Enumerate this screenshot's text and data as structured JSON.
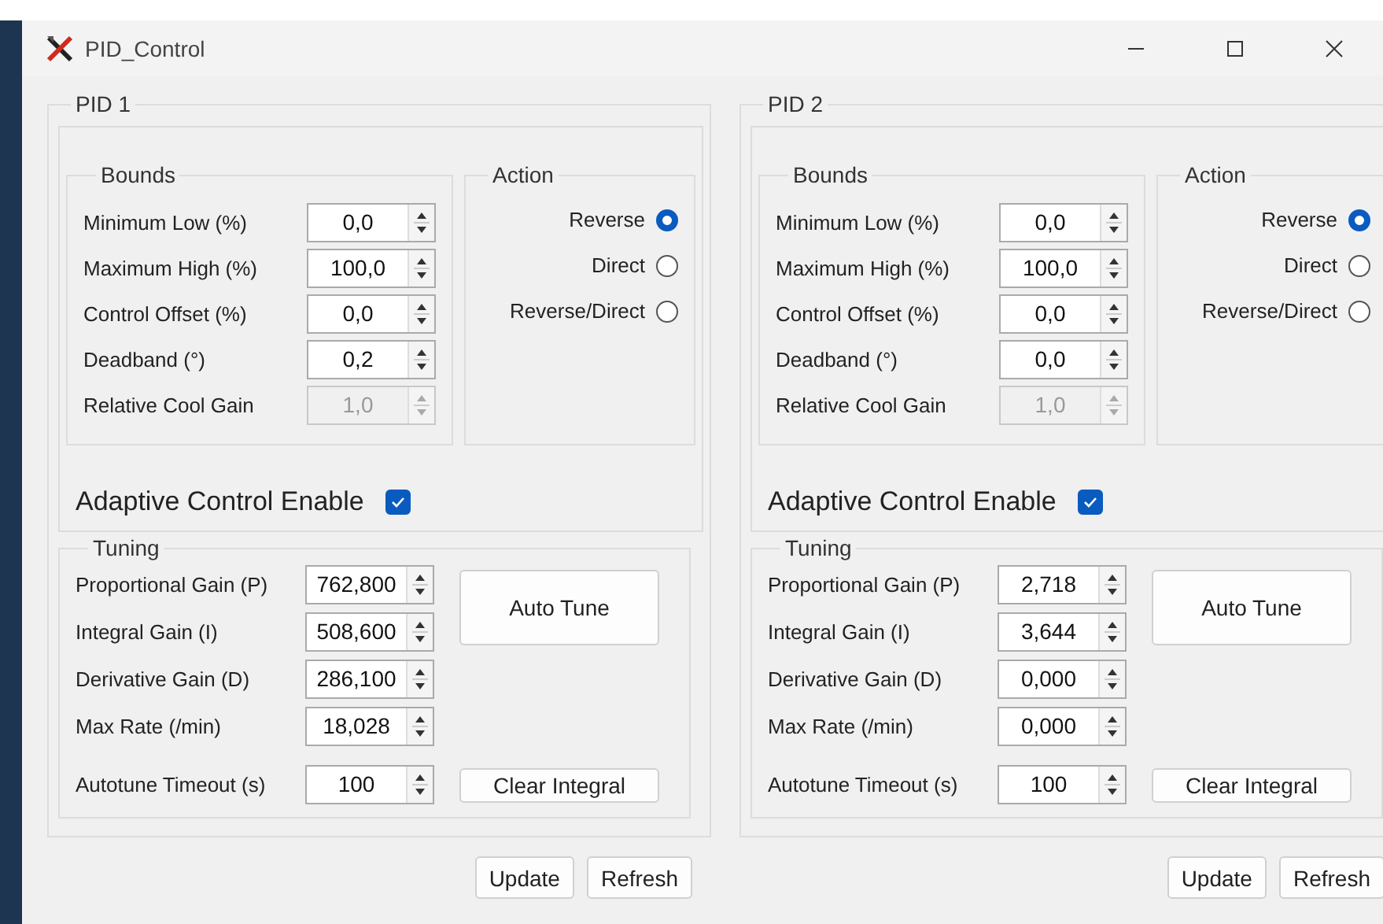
{
  "window": {
    "title": "PID_Control"
  },
  "panels": [
    {
      "title": "PID 1",
      "bounds": {
        "title": "Bounds",
        "fields": [
          {
            "label": "Minimum Low (%)",
            "value": "0,0",
            "disabled": false
          },
          {
            "label": "Maximum High (%)",
            "value": "100,0",
            "disabled": false
          },
          {
            "label": "Control Offset (%)",
            "value": "0,0",
            "disabled": false
          },
          {
            "label": "Deadband (°)",
            "value": "0,2",
            "disabled": false
          },
          {
            "label": "Relative Cool Gain",
            "value": "1,0",
            "disabled": true
          }
        ]
      },
      "action": {
        "title": "Action",
        "options": [
          {
            "label": "Reverse",
            "selected": true
          },
          {
            "label": "Direct",
            "selected": false
          },
          {
            "label": "Reverse/Direct",
            "selected": false
          }
        ]
      },
      "adaptive": {
        "label": "Adaptive Control Enable",
        "checked": true
      },
      "tuning": {
        "title": "Tuning",
        "fields": [
          {
            "label": "Proportional Gain (P)",
            "value": "762,800"
          },
          {
            "label": "Integral Gain (I)",
            "value": "508,600"
          },
          {
            "label": "Derivative Gain (D)",
            "value": "286,100"
          },
          {
            "label": "Max Rate (/min)",
            "value": "18,028"
          }
        ],
        "auto_tune_button": "Auto Tune",
        "timeout": {
          "label": "Autotune Timeout (s)",
          "value": "100"
        },
        "clear_button": "Clear Integral"
      },
      "buttons": [
        "Update",
        "Refresh"
      ]
    },
    {
      "title": "PID 2",
      "bounds": {
        "title": "Bounds",
        "fields": [
          {
            "label": "Minimum Low (%)",
            "value": "0,0",
            "disabled": false
          },
          {
            "label": "Maximum High (%)",
            "value": "100,0",
            "disabled": false
          },
          {
            "label": "Control Offset (%)",
            "value": "0,0",
            "disabled": false
          },
          {
            "label": "Deadband (°)",
            "value": "0,0",
            "disabled": false
          },
          {
            "label": "Relative Cool Gain",
            "value": "1,0",
            "disabled": true
          }
        ]
      },
      "action": {
        "title": "Action",
        "options": [
          {
            "label": "Reverse",
            "selected": true
          },
          {
            "label": "Direct",
            "selected": false
          },
          {
            "label": "Reverse/Direct",
            "selected": false
          }
        ]
      },
      "adaptive": {
        "label": "Adaptive Control Enable",
        "checked": true
      },
      "tuning": {
        "title": "Tuning",
        "fields": [
          {
            "label": "Proportional Gain (P)",
            "value": "2,718"
          },
          {
            "label": "Integral Gain (I)",
            "value": "3,644"
          },
          {
            "label": "Derivative Gain (D)",
            "value": "0,000"
          },
          {
            "label": "Max Rate (/min)",
            "value": "0,000"
          }
        ],
        "auto_tune_button": "Auto Tune",
        "timeout": {
          "label": "Autotune Timeout (s)",
          "value": "100"
        },
        "clear_button": "Clear Integral"
      },
      "buttons": [
        "Update",
        "Refresh"
      ]
    }
  ]
}
